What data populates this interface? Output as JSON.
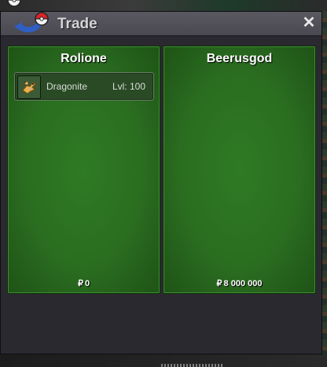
{
  "window": {
    "title": "Trade",
    "close_label": "✕"
  },
  "left_panel": {
    "player_name": "Rolione",
    "items": [
      {
        "name": "Dragonite",
        "level": "Lvl: 100",
        "icon": "dragonite-icon"
      }
    ],
    "currency_symbol": "₽",
    "money": "0"
  },
  "right_panel": {
    "player_name": "Beerusgod",
    "currency_symbol": "₽",
    "money": "8 000 000"
  },
  "colors": {
    "panel_green": "#2a6d20",
    "window_bg": "#2b2930",
    "titlebar": "#4f4d55"
  }
}
